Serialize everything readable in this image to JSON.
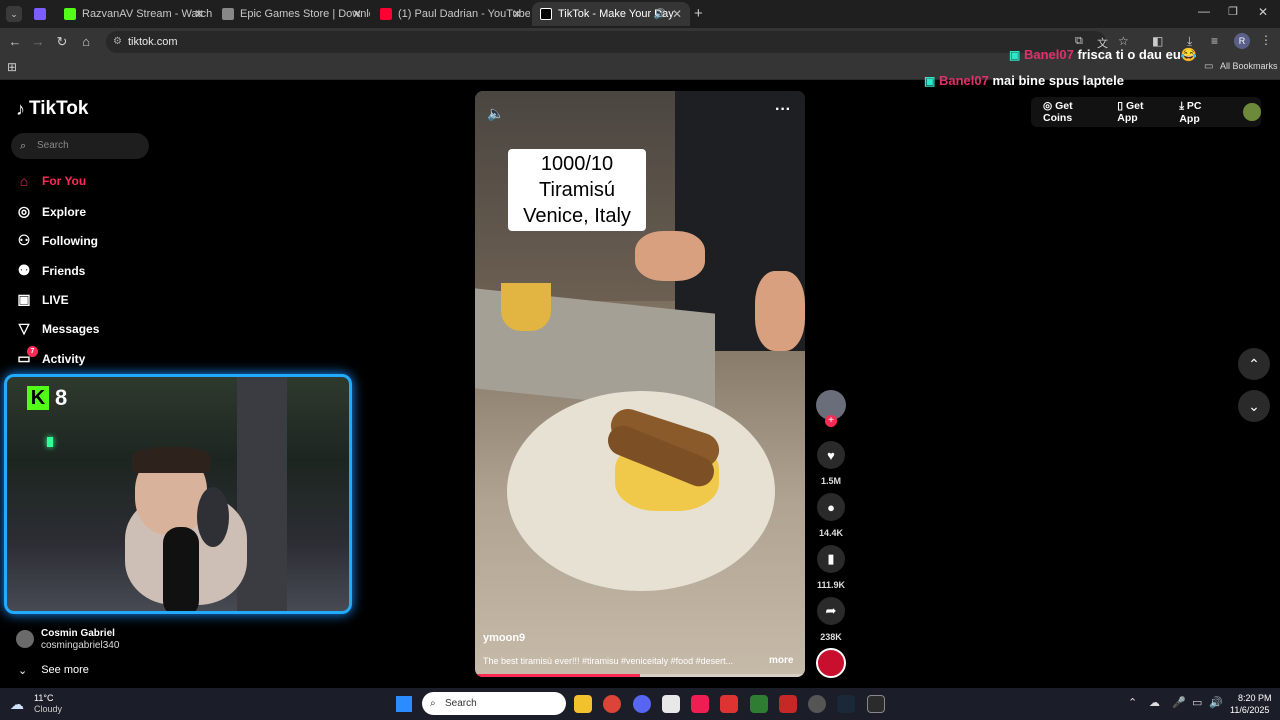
{
  "browser": {
    "tabs": [
      {
        "title": "RazvanAV Stream - Watch Live",
        "color": "#53fc18"
      },
      {
        "title": "Epic Games Store | Download &",
        "color": "#888888"
      },
      {
        "title": "(1) Paul Dadrian - YouTube",
        "color": "#ff0033"
      },
      {
        "title": "TikTok - Make Your Day",
        "color": "#ffffff"
      }
    ],
    "url": "tiktok.com",
    "all_bookmarks": "All Bookmarks"
  },
  "sidebar": {
    "logo": "TikTok",
    "search_placeholder": "Search",
    "nav": [
      {
        "label": "For You",
        "icon": "home-icon"
      },
      {
        "label": "Explore",
        "icon": "compass-icon"
      },
      {
        "label": "Following",
        "icon": "following-icon"
      },
      {
        "label": "Friends",
        "icon": "friends-icon"
      },
      {
        "label": "LIVE",
        "icon": "live-icon"
      },
      {
        "label": "Messages",
        "icon": "messages-icon"
      },
      {
        "label": "Activity",
        "icon": "activity-icon"
      }
    ],
    "activity_badge": "7",
    "account": {
      "name": "Cosmin Gabriel",
      "handle": "cosmingabriel340"
    },
    "see_more": "See more"
  },
  "webcam": {
    "overlay_label": "8",
    "accent": "#22aaff"
  },
  "video": {
    "overlay_text": [
      "1000/10",
      "Tiramisú",
      "Venice, Italy"
    ],
    "author": "ymoon9",
    "description": "The best tiramisù ever!!! #tiramisu #veniceitaly #food #desert...",
    "more": "more",
    "progress": 0.5
  },
  "actions": {
    "likes": "1.5M",
    "comments": "14.4K",
    "saves": "111.9K",
    "shares": "238K"
  },
  "top_buttons": {
    "coins": "Get Coins",
    "app": "Get App",
    "pc": "PC App"
  },
  "chat": [
    {
      "user": "Banel07",
      "message": "frisca ti o dau eu😂"
    },
    {
      "user": "Banel07",
      "message": "mai bine spus laptele"
    }
  ],
  "taskbar": {
    "weather_temp": "11°C",
    "weather_desc": "Cloudy",
    "search": "Search",
    "time": "8:20 PM",
    "date": "11/6/2025"
  }
}
